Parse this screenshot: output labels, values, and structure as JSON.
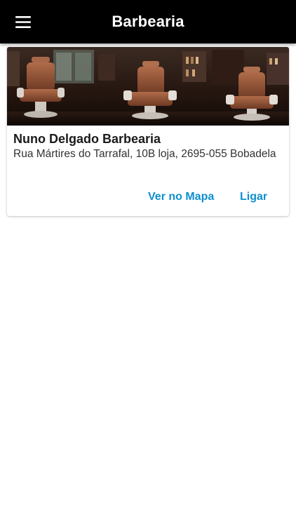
{
  "app_bar": {
    "title": "Barbearia",
    "menu_icon": "hamburger-menu-icon",
    "background": "#000000"
  },
  "card": {
    "image": "barbershop-chairs-photo",
    "title": "Nuno Delgado Barbearia",
    "address": "Rua Mártires do Tarrafal, 10B loja, 2695-055 Bobadela",
    "actions": {
      "map_label": "Ver no Mapa",
      "call_label": "Ligar"
    },
    "action_color": "#0d8fd0"
  }
}
